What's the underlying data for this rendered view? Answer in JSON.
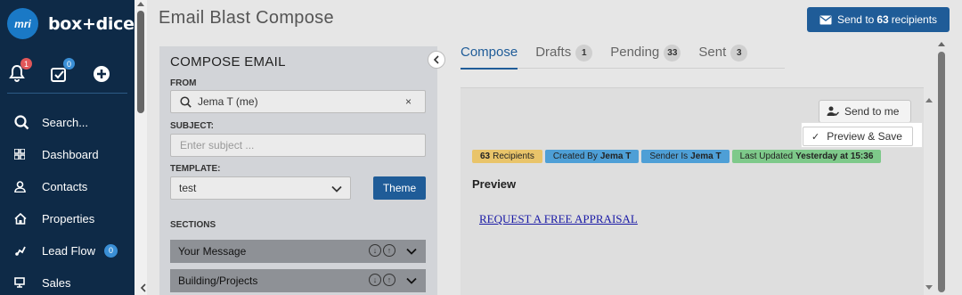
{
  "sidebar": {
    "logo_mark": "mri",
    "brand": "box+dice",
    "notifications_count": "1",
    "tasks_count": "0",
    "nav": [
      {
        "label": "Search..."
      },
      {
        "label": "Dashboard"
      },
      {
        "label": "Contacts"
      },
      {
        "label": "Properties"
      },
      {
        "label": "Lead Flow",
        "count": "0"
      },
      {
        "label": "Sales"
      }
    ]
  },
  "header": {
    "title": "Email Blast Compose",
    "send_button": {
      "prefix": "Send to",
      "count": "63",
      "suffix": "recipients"
    }
  },
  "compose": {
    "title": "COMPOSE EMAIL",
    "from_label": "FROM",
    "from_value": "Jema T (me)",
    "subject_label": "SUBJECT:",
    "subject_placeholder": "Enter subject ...",
    "template_label": "TEMPLATE:",
    "template_value": "test",
    "theme_button": "Theme",
    "sections_label": "SECTIONS",
    "sections": [
      {
        "label": "Your Message"
      },
      {
        "label": "Building/Projects"
      }
    ]
  },
  "tabs": [
    {
      "label": "Compose",
      "count": ""
    },
    {
      "label": "Drafts",
      "count": "1"
    },
    {
      "label": "Pending",
      "count": "33"
    },
    {
      "label": "Sent",
      "count": "3"
    }
  ],
  "preview": {
    "send_to_me": "Send to me",
    "preview_save": "Preview & Save",
    "badges": {
      "recipients_count": "63",
      "recipients_label": "Recipients",
      "created_by_label": "Created By",
      "created_by_value": "Jema T",
      "sender_label": "Sender Is",
      "sender_value": "Jema T",
      "updated_label": "Last Updated",
      "updated_value": "Yesterday at 15:36"
    },
    "heading": "Preview",
    "link_text": "REQUEST A FREE APPRAISAL"
  },
  "colors": {
    "sidebar_bg": "#0e2a47",
    "primary": "#1f5c98",
    "badge_yellow": "#e9c46a",
    "badge_blue": "#4e9fd6",
    "badge_green": "#7ec98a"
  }
}
